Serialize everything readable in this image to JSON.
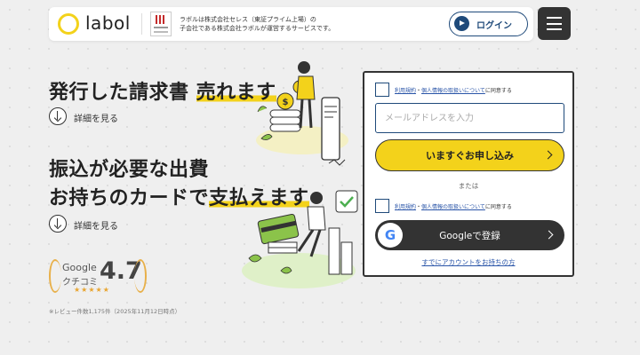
{
  "header": {
    "logo_text": "labol",
    "corp_line1": "ラボルは株式会社セレス（東証プライム上場）の",
    "corp_line2": "子会社である株式会社ラボルが運営するサービスです。",
    "login_label": "ログイン"
  },
  "hero": {
    "section1": {
      "line1_plain": "発行した請求書 ",
      "line1_highlight": "売れます",
      "more": "詳細を見る"
    },
    "section2": {
      "line1": "振込が必要な出費",
      "line2_plain": "お持ちのカードで",
      "line2_highlight": "支払えます",
      "more": "詳細を見る"
    }
  },
  "badge": {
    "google": "Google",
    "kuchikomi": "クチコミ",
    "score": "4.7",
    "stars": "★★★★★"
  },
  "note": "※レビュー件数1,175件（2025年11月12日時点）",
  "form": {
    "terms_link1": "利用規約",
    "terms_sep": "・",
    "terms_link2": "個人情報の取扱いについて",
    "terms_suffix": "に同意する",
    "email_placeholder": "メールアドレスを入力",
    "apply_label": "いますぐお申し込み",
    "or_label": "または",
    "google_g": "G",
    "google_label": "Googleで登録",
    "have_account": "すでにアカウントをお持ちの方"
  },
  "colors": {
    "accent_yellow": "#f3d21b",
    "navy": "#1f4a7a",
    "dark": "#333333",
    "link": "#2a55a8"
  },
  "icons": [
    "login-arrow-icon",
    "hamburger-menu-icon",
    "arrow-down-circle-icon",
    "external-link-icon",
    "google-g-icon",
    "chevron-right-icon"
  ]
}
